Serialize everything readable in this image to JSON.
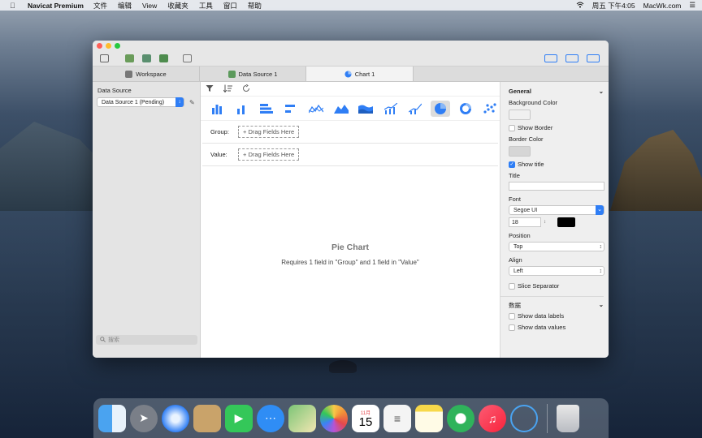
{
  "menubar": {
    "app_name": "Navicat Premium",
    "items": [
      "文件",
      "编辑",
      "View",
      "收藏夹",
      "工具",
      "窗口",
      "帮助"
    ],
    "clock": "周五 下午4:05",
    "site": "MacWk.com"
  },
  "tabs": [
    {
      "label": "Workspace",
      "icon": "workspace-icon"
    },
    {
      "label": "Data Source 1",
      "icon": "data-source-icon"
    },
    {
      "label": "Chart 1",
      "icon": "pie-chart-icon",
      "active": true
    }
  ],
  "left_panel": {
    "title": "Data Source",
    "selected_source": "Data Source 1 (Pending)",
    "search_placeholder": "搜索"
  },
  "center": {
    "group_label": "Group:",
    "value_label": "Value:",
    "drag_group": "+ Drag Fields Here",
    "drag_value": "+ Drag Fields Here",
    "chart_title": "Pie Chart",
    "chart_hint": "Requires 1 field in \"Group\" and 1 field in \"Value\"",
    "chart_types": [
      "vertical-bar",
      "grouped-bar",
      "horizontal-bar",
      "stacked-horizontal-bar",
      "line",
      "area",
      "stacked-area",
      "bar-line",
      "scatter-line",
      "pie",
      "donut",
      "scatter"
    ]
  },
  "right_panel": {
    "section_general": "General",
    "background_color": "Background Color",
    "show_border": "Show Border",
    "border_color": "Border Color",
    "show_title": "Show title",
    "title_label": "Title",
    "font_label": "Font",
    "font_value": "Segoe UI",
    "font_size": "18",
    "position_label": "Position",
    "position_value": "Top",
    "align_label": "Align",
    "align_value": "Left",
    "slice_separator": "Slice Separator",
    "section_data": "数据",
    "show_data_labels": "Show data labels",
    "show_data_values": "Show data values"
  },
  "dock": {
    "calendar_month": "11月",
    "calendar_day": "15"
  },
  "colors": {
    "accent": "#2f7ef5",
    "close": "#fe5f57",
    "minimize": "#febc2e",
    "maximize": "#28c840"
  }
}
